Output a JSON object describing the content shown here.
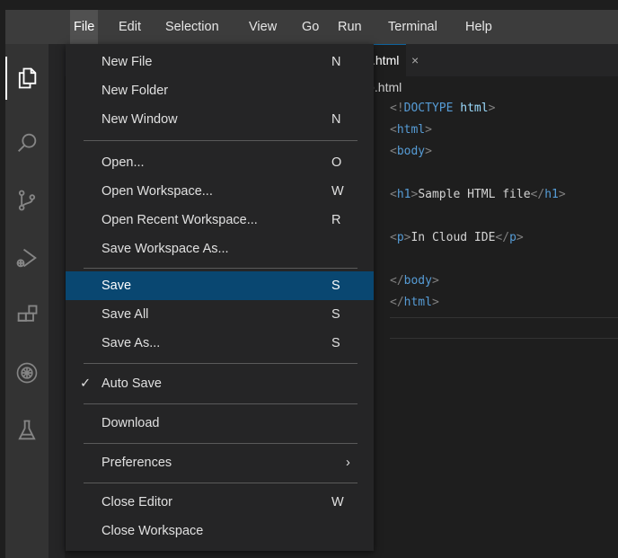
{
  "menubar": {
    "items": [
      "File",
      "Edit",
      "Selection",
      "View",
      "Go",
      "Run",
      "Terminal",
      "Help"
    ]
  },
  "editor": {
    "tab_label": ".html",
    "tab_close": "×",
    "breadcrumb": "le.html",
    "code": [
      "<!DOCTYPE html>",
      "<html>",
      "<body>",
      "",
      "<h1>Sample HTML file</h1>",
      "",
      "<p>In Cloud IDE</p>",
      "",
      "</body>",
      "</html>"
    ]
  },
  "file_menu": {
    "items": [
      {
        "label": "New File",
        "key": "N"
      },
      {
        "label": "New Folder",
        "key": ""
      },
      {
        "label": "New Window",
        "key": "N"
      },
      {
        "label": "Open...",
        "key": "O"
      },
      {
        "label": "Open Workspace...",
        "key": "W"
      },
      {
        "label": "Open Recent Workspace...",
        "key": "R"
      },
      {
        "label": "Save Workspace As...",
        "key": ""
      },
      {
        "label": "Save",
        "key": "S"
      },
      {
        "label": "Save All",
        "key": "S"
      },
      {
        "label": "Save As...",
        "key": "S"
      },
      {
        "label": "Auto Save",
        "key": ""
      },
      {
        "label": "Download",
        "key": ""
      },
      {
        "label": "Preferences",
        "key": ""
      },
      {
        "label": "Close Editor",
        "key": "W"
      },
      {
        "label": "Close Workspace",
        "key": ""
      }
    ],
    "checkmark": "✓",
    "submenu_arrow": "›"
  },
  "colors": {
    "selection": "#094771",
    "menu_bg": "#252526",
    "keyword": "#569cd6"
  },
  "activity_icons": [
    "explorer-icon",
    "search-icon",
    "source-control-icon",
    "run-debug-icon",
    "extensions-icon",
    "kubernetes-icon",
    "testing-flask-icon"
  ]
}
